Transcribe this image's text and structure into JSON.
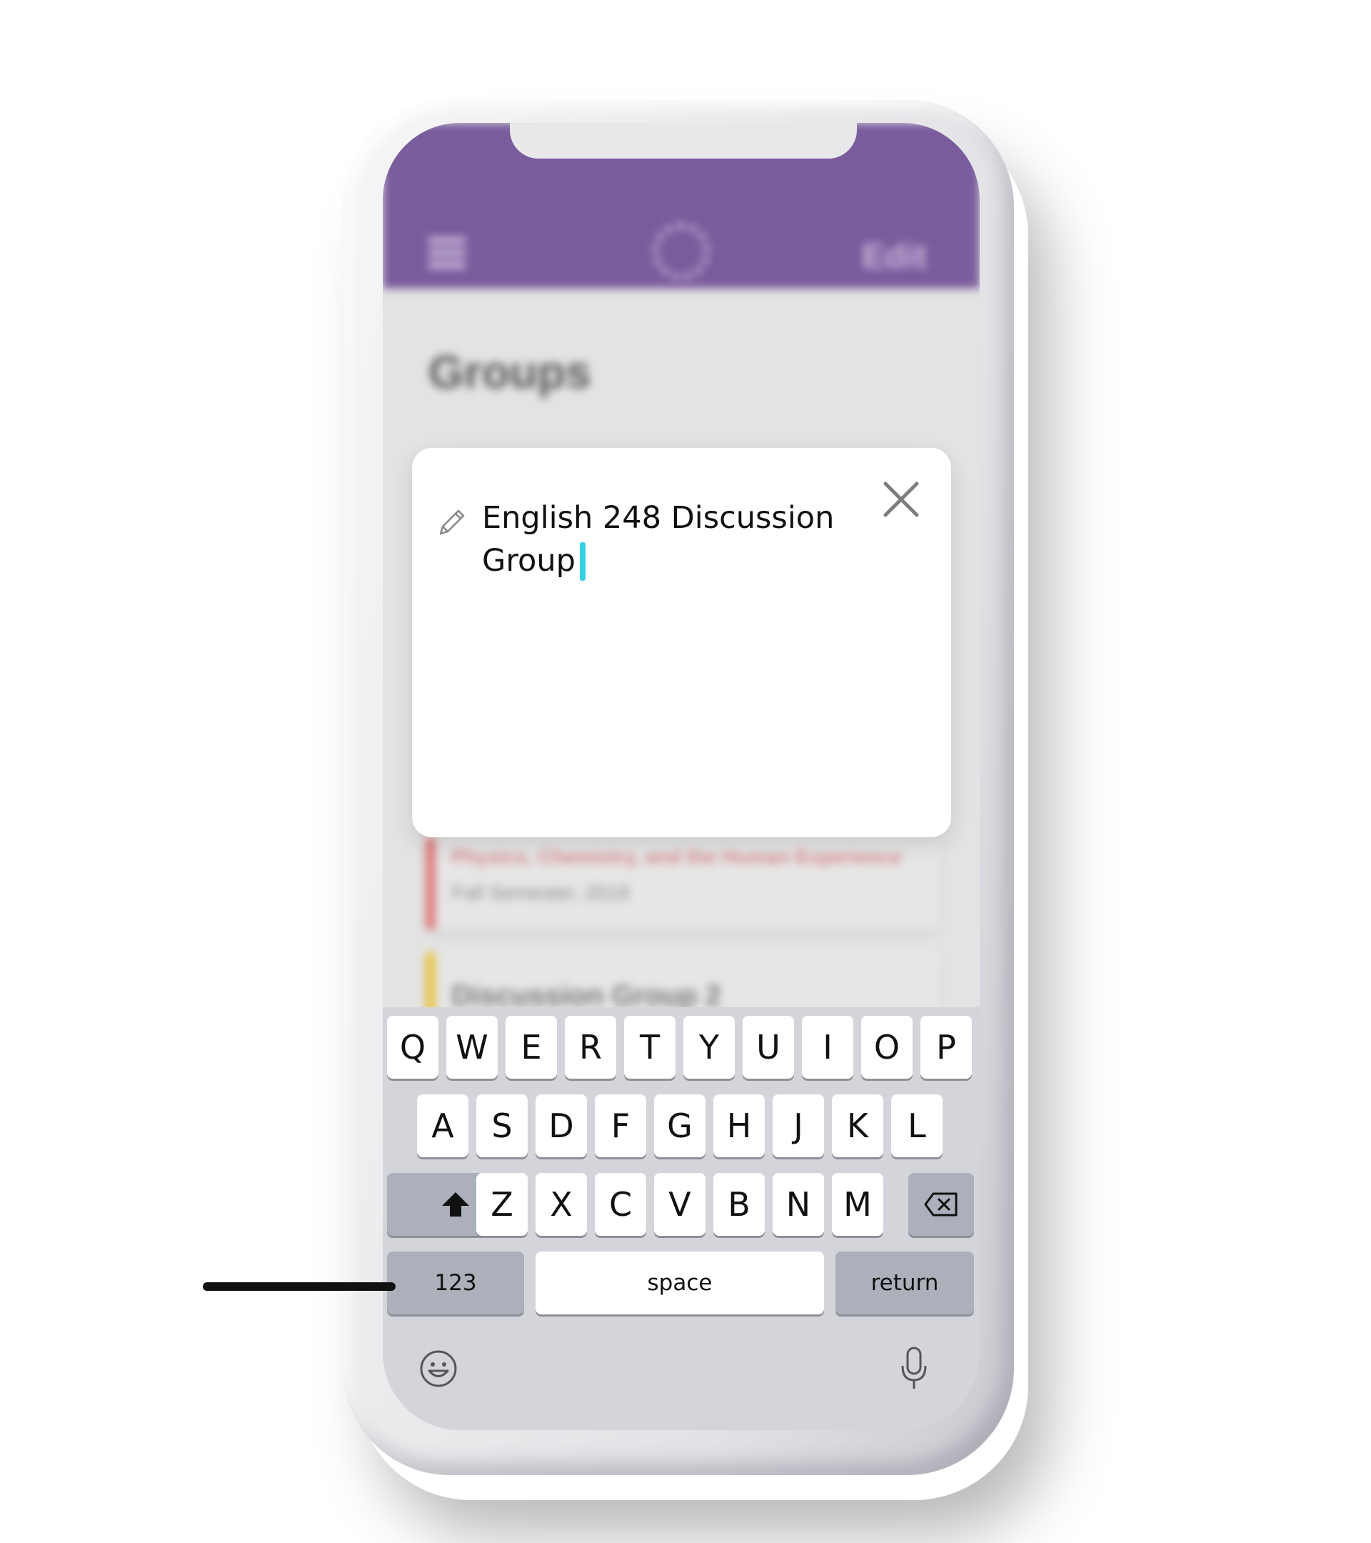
{
  "header": {
    "edit_label": "Edit",
    "menu_icon": "hamburger-menu-icon",
    "logo_icon": "app-logo-icon",
    "accent_color": "#7a5b9c"
  },
  "page": {
    "title": "Groups"
  },
  "groups": [
    {
      "name": "Physics, Chemistry, and the Human Experience",
      "subtitle": "Fall Semester, 2019",
      "color": "#e07a7a"
    },
    {
      "name": "Discussion Group 2",
      "subtitle": "",
      "color": "#e8c64a"
    }
  ],
  "dialog": {
    "group_name_value": "English 248 Discussion Group",
    "edit_icon": "pencil-icon",
    "close_icon": "close-icon",
    "caret_color": "#35d0e6"
  },
  "keyboard": {
    "row1": [
      "Q",
      "W",
      "E",
      "R",
      "T",
      "Y",
      "U",
      "I",
      "O",
      "P"
    ],
    "row2": [
      "A",
      "S",
      "D",
      "F",
      "G",
      "H",
      "J",
      "K",
      "L"
    ],
    "row3": [
      "Z",
      "X",
      "C",
      "V",
      "B",
      "N",
      "M"
    ],
    "numbers_label": "123",
    "space_label": "space",
    "return_label": "return",
    "shift_icon": "shift-icon",
    "delete_icon": "backspace-icon",
    "emoji_icon": "emoji-icon",
    "mic_icon": "microphone-icon"
  }
}
